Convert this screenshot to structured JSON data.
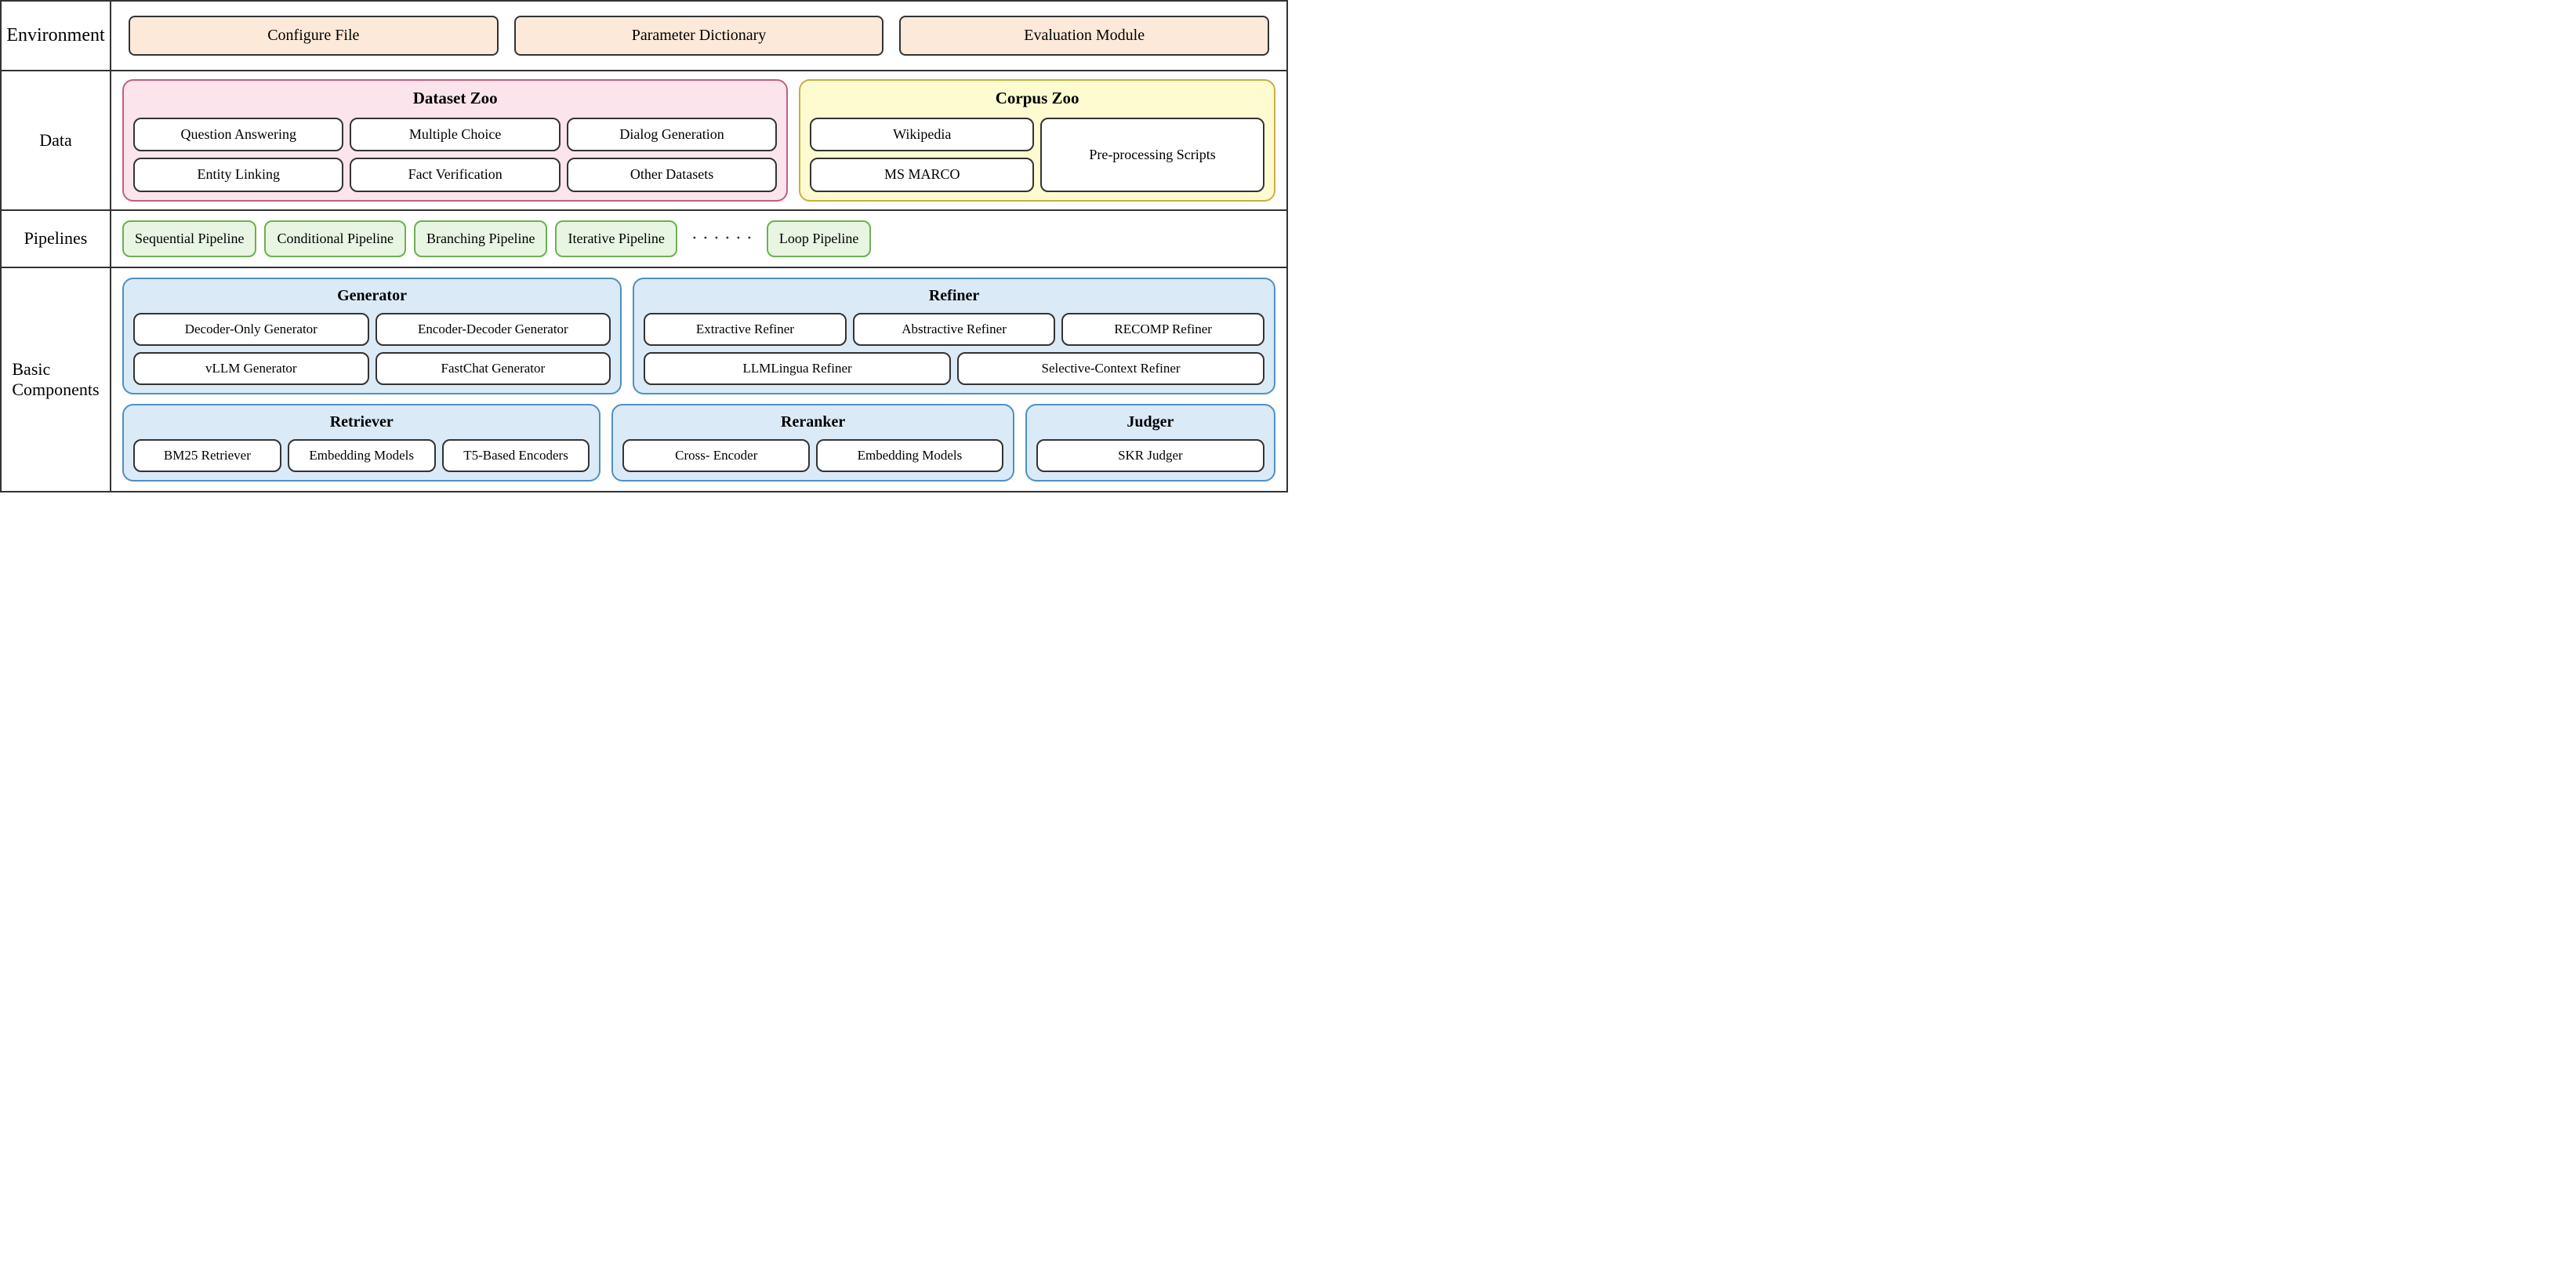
{
  "environment": {
    "label": "Environment",
    "boxes": [
      {
        "id": "configure-file",
        "text": "Configure File"
      },
      {
        "id": "parameter-dictionary",
        "text": "Parameter Dictionary"
      },
      {
        "id": "evaluation-module",
        "text": "Evaluation Module"
      }
    ]
  },
  "data": {
    "label": "Data",
    "dataset_zoo": {
      "title": "Dataset Zoo",
      "items": [
        {
          "id": "question-answering",
          "text": "Question\nAnswering"
        },
        {
          "id": "multiple-choice",
          "text": "Multiple\nChoice"
        },
        {
          "id": "dialog-generation",
          "text": "Dialog\nGeneration"
        },
        {
          "id": "entity-linking",
          "text": "Entity Linking"
        },
        {
          "id": "fact-verification",
          "text": "Fact\nVerification"
        },
        {
          "id": "other-datasets",
          "text": "Other\nDatasets"
        }
      ]
    },
    "corpus_zoo": {
      "title": "Corpus Zoo",
      "left_items": [
        {
          "id": "wikipedia",
          "text": "Wikipedia"
        },
        {
          "id": "ms-marco",
          "text": "MS MARCO"
        }
      ],
      "right_item": {
        "id": "preprocessing-scripts",
        "text": "Pre-processing\nScripts"
      }
    }
  },
  "pipelines": {
    "label": "Pipelines",
    "items": [
      {
        "id": "sequential-pipeline",
        "text": "Sequential\nPipeline"
      },
      {
        "id": "conditional-pipeline",
        "text": "Conditional\nPipeline"
      },
      {
        "id": "branching-pipeline",
        "text": "Branching\nPipeline"
      },
      {
        "id": "iterative-pipeline",
        "text": "Iterative\nPipeline"
      },
      {
        "id": "loop-pipeline",
        "text": "Loop Pipeline"
      }
    ],
    "dots": "· · · · · ·"
  },
  "basic_components": {
    "label": "Basic\nComponents",
    "generator": {
      "title": "Generator",
      "items": [
        {
          "id": "decoder-only-generator",
          "text": "Decoder-Only\nGenerator"
        },
        {
          "id": "encoder-decoder-generator",
          "text": "Encoder-Decoder\nGenerator"
        },
        {
          "id": "vllm-generator",
          "text": "vLLM Generator"
        },
        {
          "id": "fastchat-generator",
          "text": "FastChat Generator"
        }
      ]
    },
    "refiner": {
      "title": "Refiner",
      "top_items": [
        {
          "id": "extractive-refiner",
          "text": "Extractive\nRefiner"
        },
        {
          "id": "abstractive-refiner",
          "text": "Abstractive\nRefiner"
        },
        {
          "id": "recomp-refiner",
          "text": "RECOMP\nRefiner"
        }
      ],
      "bottom_items": [
        {
          "id": "llmlingua-refiner",
          "text": "LLMLingua Refiner"
        },
        {
          "id": "selective-context-refiner",
          "text": "Selective-Context\nRefiner"
        }
      ]
    },
    "retriever": {
      "title": "Retriever",
      "items": [
        {
          "id": "bm25-retriever",
          "text": "BM25\nRetriever"
        },
        {
          "id": "embedding-models-retriever",
          "text": "Embedding\nModels"
        },
        {
          "id": "t5-based-encoders",
          "text": "T5-Based\nEncoders"
        }
      ]
    },
    "reranker": {
      "title": "Reranker",
      "items": [
        {
          "id": "cross-encoder",
          "text": "Cross-\nEncoder"
        },
        {
          "id": "embedding-models-reranker",
          "text": "Embedding\nModels"
        }
      ]
    },
    "judger": {
      "title": "Judger",
      "items": [
        {
          "id": "skr-judger",
          "text": "SKR Judger"
        }
      ]
    }
  }
}
